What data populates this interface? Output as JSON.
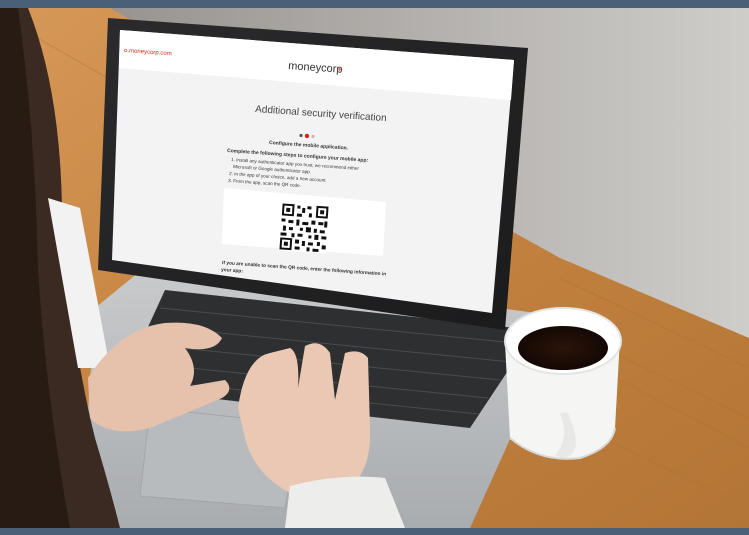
{
  "screen": {
    "url_text": "o.moneycorp.com",
    "brand": "moneycorp",
    "heading": "Additional security verification",
    "subheading": "Configure the mobile application.",
    "intro": "Complete the following steps to configure your mobile app:",
    "steps": [
      "1. Install any authenticator app you trust, we recommend either",
      "Microsoft or Google authenticator app.",
      "2. In the app of your choice, add a new account.",
      "3. From the app, scan the QR code."
    ],
    "fallback_line1": "If you are unable to scan the QR code, enter the following information in",
    "fallback_line2": "your app:"
  },
  "colors": {
    "brand_accent": "#e2231a",
    "border": "#4a6078",
    "wood": "#c98a4b",
    "laptop": "#bfc2c5"
  },
  "icons": [
    "qr-code-icon",
    "progress-dots-icon"
  ]
}
